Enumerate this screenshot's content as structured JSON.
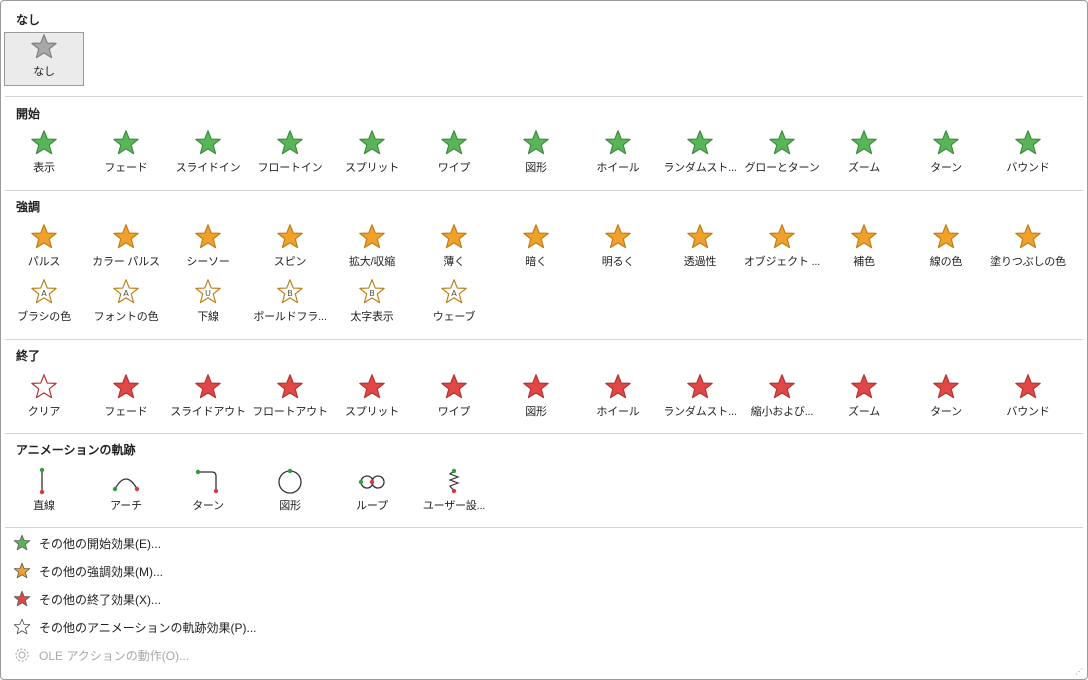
{
  "sections": {
    "none": {
      "title": "なし",
      "items": [
        {
          "label": "なし"
        }
      ]
    },
    "entrance": {
      "title": "開始",
      "items": [
        {
          "label": "表示"
        },
        {
          "label": "フェード"
        },
        {
          "label": "スライドイン"
        },
        {
          "label": "フロートイン"
        },
        {
          "label": "スプリット"
        },
        {
          "label": "ワイプ"
        },
        {
          "label": "図形"
        },
        {
          "label": "ホイール"
        },
        {
          "label": "ランダムスト..."
        },
        {
          "label": "グローとターン"
        },
        {
          "label": "ズーム"
        },
        {
          "label": "ターン"
        },
        {
          "label": "バウンド"
        }
      ]
    },
    "emphasis": {
      "title": "強調",
      "items": [
        {
          "label": "パルス"
        },
        {
          "label": "カラー パルス"
        },
        {
          "label": "シーソー"
        },
        {
          "label": "スピン"
        },
        {
          "label": "拡大/収縮"
        },
        {
          "label": "薄く"
        },
        {
          "label": "暗く"
        },
        {
          "label": "明るく"
        },
        {
          "label": "透過性"
        },
        {
          "label": "オブジェクト ..."
        },
        {
          "label": "補色"
        },
        {
          "label": "線の色"
        },
        {
          "label": "塗りつぶしの色"
        },
        {
          "label": "ブラシの色",
          "glyph": "A"
        },
        {
          "label": "フォントの色",
          "glyph": "A"
        },
        {
          "label": "下線",
          "glyph": "U"
        },
        {
          "label": "ボールドフラ...",
          "glyph": "B"
        },
        {
          "label": "太字表示",
          "glyph": "B"
        },
        {
          "label": "ウェーブ",
          "glyph": "A"
        }
      ]
    },
    "exit": {
      "title": "終了",
      "items": [
        {
          "label": "クリア"
        },
        {
          "label": "フェード"
        },
        {
          "label": "スライドアウト"
        },
        {
          "label": "フロートアウト"
        },
        {
          "label": "スプリット"
        },
        {
          "label": "ワイプ"
        },
        {
          "label": "図形"
        },
        {
          "label": "ホイール"
        },
        {
          "label": "ランダムスト..."
        },
        {
          "label": "縮小および..."
        },
        {
          "label": "ズーム"
        },
        {
          "label": "ターン"
        },
        {
          "label": "バウンド"
        }
      ]
    },
    "motion": {
      "title": "アニメーションの軌跡",
      "items": [
        {
          "label": "直線"
        },
        {
          "label": "アーチ"
        },
        {
          "label": "ターン"
        },
        {
          "label": "図形"
        },
        {
          "label": "ループ"
        },
        {
          "label": "ユーザー設..."
        }
      ]
    }
  },
  "menu": [
    {
      "label": "その他の開始効果(E)...",
      "color": "#5ab55a"
    },
    {
      "label": "その他の強調効果(M)...",
      "color": "#f0a12b"
    },
    {
      "label": "その他の終了効果(X)...",
      "color": "#e04848"
    },
    {
      "label": "その他のアニメーションの軌跡効果(P)...",
      "color": "#ffffff"
    },
    {
      "label": "OLE アクションの動作(O)...",
      "disabled": true
    }
  ],
  "colors": {
    "entrance": "#5ab55a",
    "emphasis": "#f0a12b",
    "exit": "#e04848",
    "none": "#9e9e9e"
  }
}
